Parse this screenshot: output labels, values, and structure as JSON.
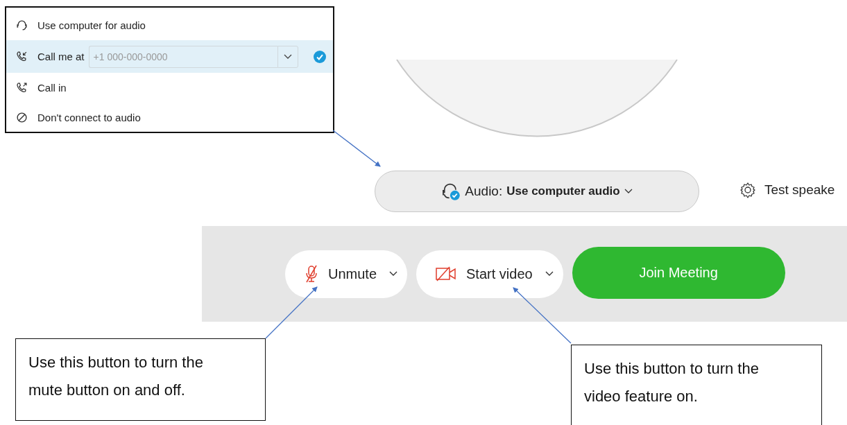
{
  "audio_menu": {
    "items": [
      {
        "kind": "computer",
        "label": "Use computer for audio",
        "selected": false
      },
      {
        "kind": "call_me",
        "label": "Call me at",
        "selected": true,
        "field": {
          "placeholder": "+1 000-000-0000"
        }
      },
      {
        "kind": "call_in",
        "label": "Call in",
        "selected": false
      },
      {
        "kind": "none",
        "label": "Don't connect to audio",
        "selected": false
      }
    ]
  },
  "audio_button": {
    "label": "Audio:",
    "value": "Use computer audio"
  },
  "test_speaker": {
    "label": "Test speake"
  },
  "controls": [
    {
      "kind": "mic",
      "label": "Unmute",
      "on": false
    },
    {
      "kind": "video",
      "label": "Start video",
      "on": false
    }
  ],
  "join_button": {
    "label": "Join Meeting"
  },
  "callouts": [
    {
      "text": "Use this button to turn the mute button on and off."
    },
    {
      "text": "Use this button to turn the video feature on."
    }
  ]
}
